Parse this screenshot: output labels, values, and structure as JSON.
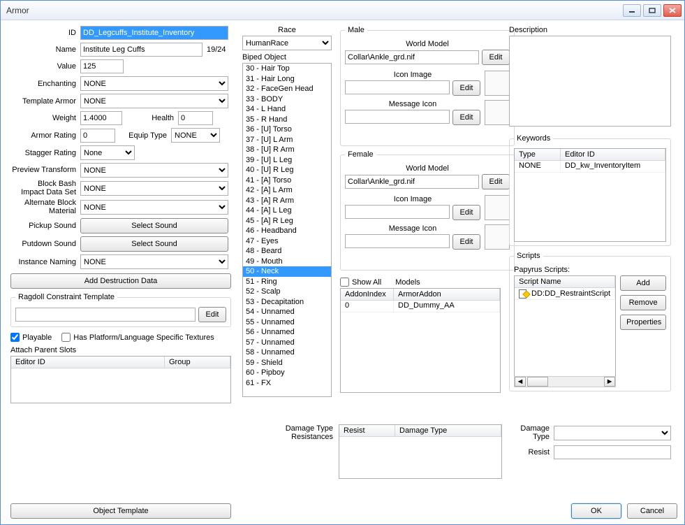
{
  "window_title": "Armor",
  "labels": {
    "id": "ID",
    "name": "Name",
    "value": "Value",
    "enchanting": "Enchanting",
    "template_armor": "Template Armor",
    "weight": "Weight",
    "health": "Health",
    "armor_rating": "Armor Rating",
    "equip_type": "Equip Type",
    "stagger_rating": "Stagger Rating",
    "preview_transform": "Preview Transform",
    "block_bash": "Block Bash Impact Data Set",
    "alt_block": "Alternate Block Material",
    "pickup_sound": "Pickup Sound",
    "putdown_sound": "Putdown Sound",
    "instance_naming": "Instance Naming",
    "add_destruction": "Add Destruction Data",
    "ragdoll_template": "Ragdoll Constraint Template",
    "edit": "Edit",
    "playable": "Playable",
    "has_platform": "Has Platform/Language Specific Textures",
    "attach_parent": "Attach Parent Slots",
    "editor_id": "Editor ID",
    "group": "Group",
    "race": "Race",
    "biped_object": "Biped Object",
    "male": "Male",
    "female": "Female",
    "world_model": "World Model",
    "icon_image": "Icon Image",
    "message_icon": "Message Icon",
    "show_all": "Show All",
    "models": "Models",
    "addon_index": "AddonIndex",
    "armor_addon": "ArmorAddon",
    "description": "Description",
    "keywords": "Keywords",
    "type": "Type",
    "scripts": "Scripts",
    "papyrus": "Papyrus Scripts:",
    "script_name": "Script Name",
    "add": "Add",
    "remove": "Remove",
    "properties": "Properties",
    "dmg_type_res": "Damage Type Resistances",
    "resist": "Resist",
    "damage_type": "Damage Type",
    "object_template": "Object Template",
    "ok": "OK",
    "cancel": "Cancel",
    "name_counter": "19/24",
    "select_sound": "Select Sound"
  },
  "values": {
    "id": "DD_Legcuffs_Institute_Inventory",
    "name": "Institute Leg Cuffs",
    "value": "125",
    "enchanting": "NONE",
    "template_armor": "NONE",
    "weight": "1.4000",
    "health": "0",
    "armor_rating": "0",
    "equip_type": "NONE",
    "stagger_rating": "None",
    "preview_transform": "NONE",
    "block_bash": "NONE",
    "alt_block": "NONE",
    "instance_naming": "NONE",
    "race": "HumanRace",
    "male_world_model": "Collar\\Ankle_grd.nif",
    "female_world_model": "Collar\\Ankle_grd.nif",
    "playable": true,
    "has_platform": false,
    "show_all": false
  },
  "biped_objects": [
    "30 - Hair Top",
    "31 - Hair Long",
    "32 - FaceGen Head",
    "33 - BODY",
    "34 - L Hand",
    "35 - R Hand",
    "36 - [U] Torso",
    "37 - [U] L Arm",
    "38 - [U] R Arm",
    "39 - [U] L Leg",
    "40 - [U] R Leg",
    "41 - [A] Torso",
    "42 - [A] L Arm",
    "43 - [A] R Arm",
    "44 - [A] L Leg",
    "45 - [A] R Leg",
    "46 - Headband",
    "47 - Eyes",
    "48 - Beard",
    "49 - Mouth",
    "50 - Neck",
    "51 - Ring",
    "52 - Scalp",
    "53 - Decapitation",
    "54 - Unnamed",
    "55 - Unnamed",
    "56 - Unnamed",
    "57 - Unnamed",
    "58 - Unnamed",
    "59 - Shield",
    "60 - Pipboy",
    "61 - FX"
  ],
  "biped_selected_index": 20,
  "models": [
    {
      "index": "0",
      "addon": "DD_Dummy_AA"
    }
  ],
  "keywords": [
    {
      "type": "NONE",
      "editor_id": "DD_kw_InventoryItem"
    }
  ],
  "scripts": [
    {
      "name": "DD:DD_RestraintScript"
    }
  ]
}
